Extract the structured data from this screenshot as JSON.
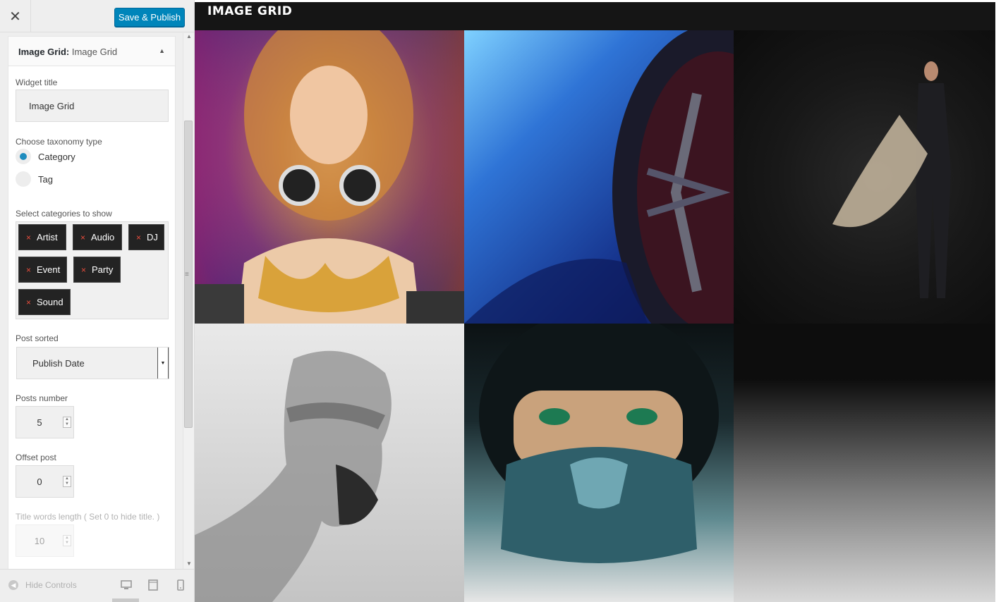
{
  "topbar": {
    "close_glyph": "✕",
    "save_label": "Save & Publish"
  },
  "widget": {
    "header_bold": "Image Grid:",
    "header_sub": " Image Grid",
    "toggle_glyph": "▲",
    "title_label": "Widget title",
    "title_value": "Image Grid",
    "taxonomy_label": "Choose taxonomy type",
    "taxonomy_options": [
      {
        "label": "Category",
        "checked": true
      },
      {
        "label": "Tag",
        "checked": false
      }
    ],
    "categories_label": "Select categories to show",
    "categories": [
      "Artist",
      "Audio",
      "DJ",
      "Event",
      "Party",
      "Sound"
    ],
    "chip_remove_glyph": "×",
    "sort_label": "Post sorted",
    "sort_value": "Publish Date",
    "posts_number_label": "Posts number",
    "posts_number_value": "5",
    "offset_label": "Offset post",
    "offset_value": "0",
    "title_words_label": "Title words length ( Set 0 to hide title. )",
    "title_words_value": "10"
  },
  "bottombar": {
    "hide_controls_label": "Hide Controls",
    "devices": [
      "desktop-icon",
      "tablet-icon",
      "mobile-icon"
    ]
  },
  "preview": {
    "title": "IMAGE GRID",
    "tiles": [
      {
        "name": "dj-woman-headphones-image"
      },
      {
        "name": "blue-car-wheel-image"
      },
      {
        "name": "man-with-surfboard-image"
      },
      {
        "name": "bearded-man-double-exposure-image"
      },
      {
        "name": "woman-in-motorcycle-helmet-image"
      }
    ]
  },
  "colors": {
    "accent": "#0085ba",
    "radio_checked": "#1e8cbe",
    "chip_bg": "#232323",
    "chip_remove": "#e74c3c",
    "preview_bg": "#111111"
  }
}
